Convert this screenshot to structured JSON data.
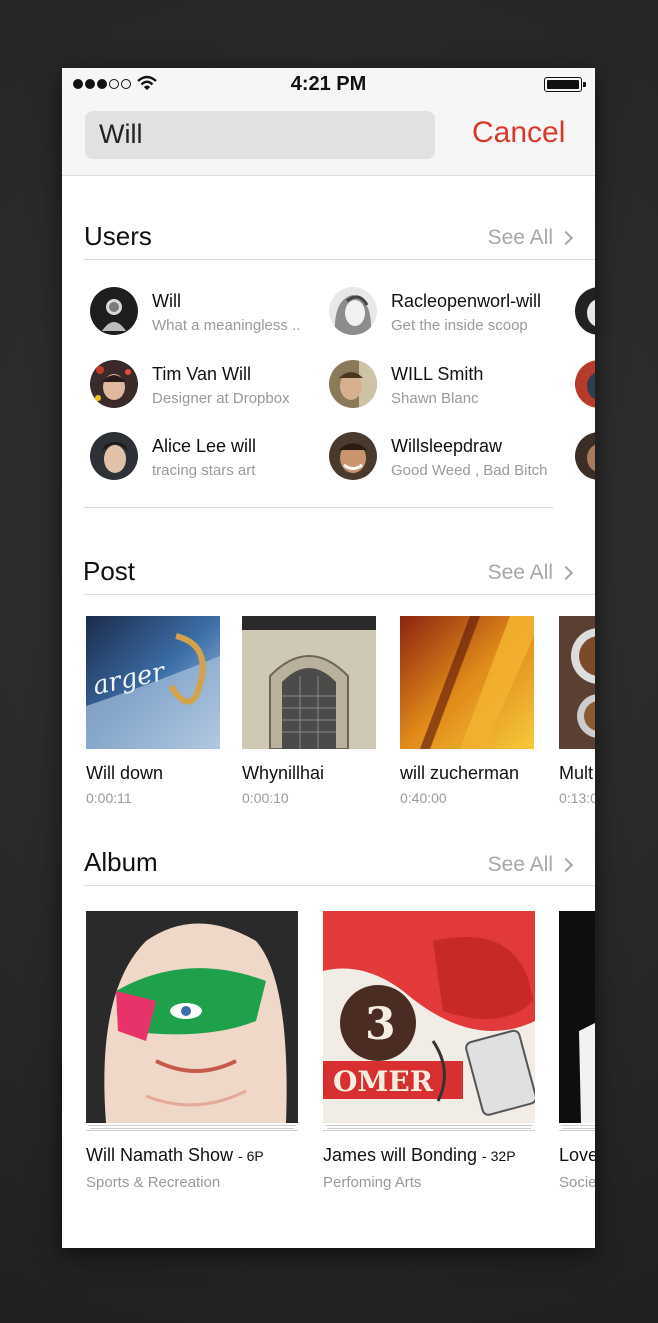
{
  "status_bar": {
    "time": "4:21 PM"
  },
  "search": {
    "query": "Will",
    "cancel_label": "Cancel"
  },
  "users": {
    "title": "Users",
    "see_all": "See All",
    "items": [
      {
        "name": "Will",
        "subtitle": "What a meaningless .."
      },
      {
        "name": "Racleopenworl-will",
        "subtitle": "Get the inside scoop"
      },
      {
        "name": "Tim Van Will",
        "subtitle": "Designer at Dropbox"
      },
      {
        "name": "WILL Smith",
        "subtitle": "Shawn Blanc"
      },
      {
        "name": "Alice Lee will",
        "subtitle": "tracing stars art"
      },
      {
        "name": "Willsleepdraw",
        "subtitle": "Good Weed , Bad Bitch"
      }
    ]
  },
  "posts": {
    "title": "Post",
    "see_all": "See All",
    "items": [
      {
        "title": "Will down",
        "duration": "0:00:11"
      },
      {
        "title": "Whynillhai",
        "duration": "0:00:10"
      },
      {
        "title": "will zucherman",
        "duration": "0:40:00"
      },
      {
        "title": "Mult",
        "duration": "0:13:0"
      }
    ]
  },
  "albums": {
    "title": "Album",
    "see_all": "See All",
    "items": [
      {
        "title": "Will Namath Show",
        "count": "- 6P",
        "category": "Sports & Recreation"
      },
      {
        "title": "James will Bonding",
        "count": "- 32P",
        "category": "Perfoming Arts"
      },
      {
        "title": "Love",
        "count": "",
        "category": "Socie"
      }
    ]
  },
  "colors": {
    "accent": "#d8392b",
    "secondary_text": "#9a9a9a"
  }
}
